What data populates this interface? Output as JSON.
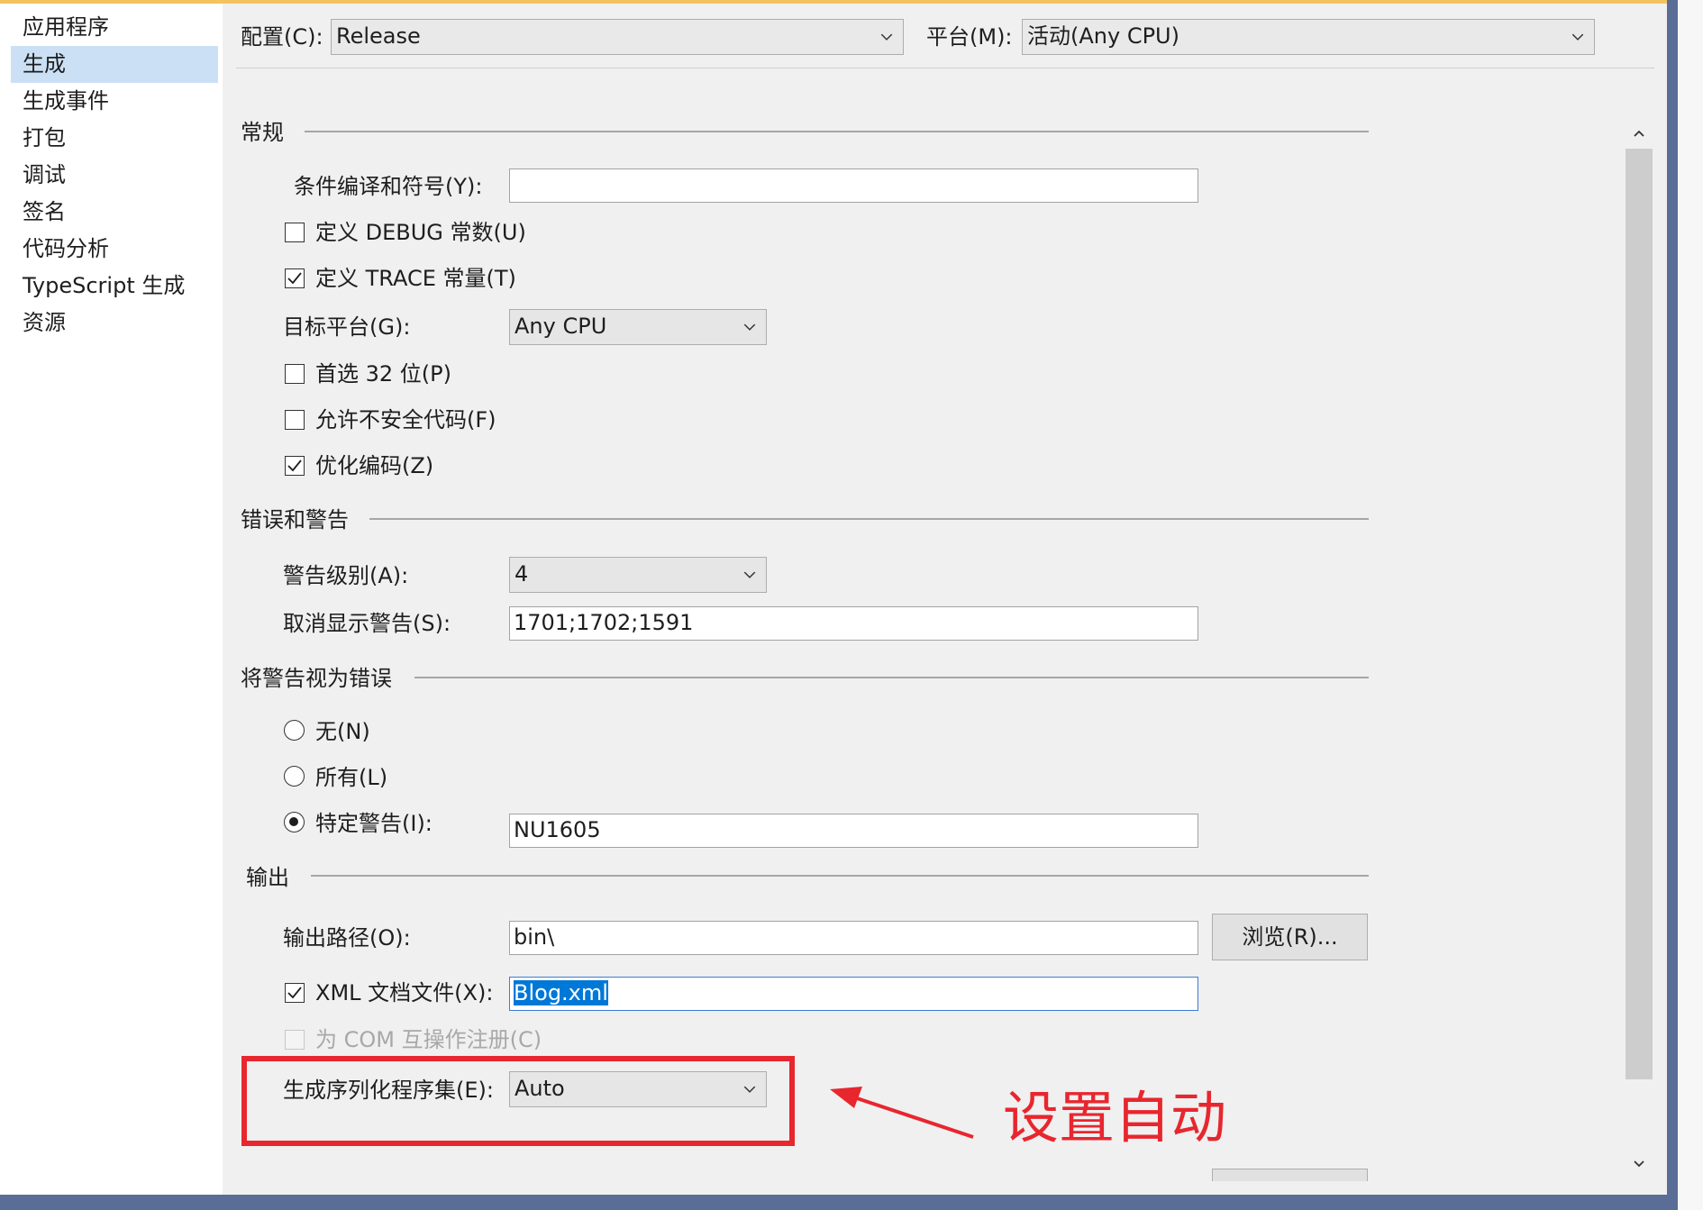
{
  "sidebar": {
    "items": [
      {
        "label": "应用程序"
      },
      {
        "label": "生成",
        "selected": true
      },
      {
        "label": "生成事件"
      },
      {
        "label": "打包"
      },
      {
        "label": "调试"
      },
      {
        "label": "签名"
      },
      {
        "label": "代码分析"
      },
      {
        "label": "TypeScript 生成"
      },
      {
        "label": "资源"
      }
    ]
  },
  "header": {
    "config_label": "配置(C):",
    "config_value": "Release",
    "platform_label": "平台(M):",
    "platform_value": "活动(Any CPU)"
  },
  "sections": {
    "general": {
      "title": "常规",
      "conditional_symbols_label": "条件编译和符号(Y):",
      "conditional_symbols_value": "",
      "define_debug_label": "定义 DEBUG 常数(U)",
      "define_debug_checked": false,
      "define_trace_label": "定义 TRACE 常量(T)",
      "define_trace_checked": true,
      "target_platform_label": "目标平台(G):",
      "target_platform_value": "Any CPU",
      "prefer32_label": "首选 32 位(P)",
      "prefer32_checked": false,
      "unsafe_label": "允许不安全代码(F)",
      "unsafe_checked": false,
      "optimize_label": "优化编码(Z)",
      "optimize_checked": true
    },
    "errors": {
      "title": "错误和警告",
      "warning_level_label": "警告级别(A):",
      "warning_level_value": "4",
      "suppress_label": "取消显示警告(S):",
      "suppress_value": "1701;1702;1591"
    },
    "treat_warnings": {
      "title": "将警告视为错误",
      "none_label": "无(N)",
      "all_label": "所有(L)",
      "specific_label": "特定警告(I):",
      "specific_value": "NU1605",
      "selected": "specific"
    },
    "output": {
      "title": "输出",
      "path_label": "输出路径(O):",
      "path_value": "bin\\",
      "browse_label": "浏览(R)...",
      "xml_label": "XML 文档文件(X):",
      "xml_checked": true,
      "xml_value": "Blog.xml",
      "com_label": "为 COM 互操作注册(C)",
      "com_checked": false,
      "serialization_label": "生成序列化程序集(E):",
      "serialization_value": "Auto"
    }
  },
  "annotation": {
    "text": "设置自动",
    "color": "#e8262e"
  },
  "colors": {
    "sidebar_selected": "#cce0f5",
    "accent": "#f2c35f",
    "text_highlight": "#0078d7"
  }
}
